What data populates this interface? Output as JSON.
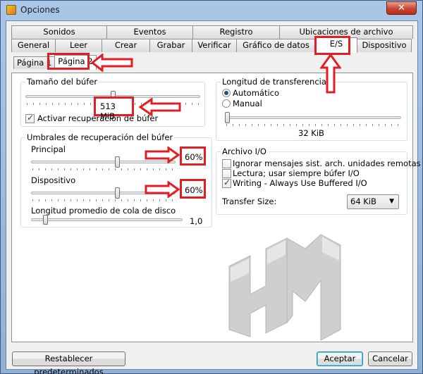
{
  "window": {
    "title": "Opciones",
    "close_glyph": "✕"
  },
  "tabs_row1": [
    "Sonidos",
    "Eventos",
    "Registro",
    "Ubicaciones de archivo"
  ],
  "tabs_row2": [
    "General",
    "Leer",
    "Crear",
    "Grabar",
    "Verificar",
    "Gráfico de datos",
    "E/S",
    "Dispositivo"
  ],
  "active_tab": "E/S",
  "subtabs": [
    "Página 1",
    "Página 2"
  ],
  "active_subtab": "Página 2",
  "buffer": {
    "title": "Tamaño del búfer",
    "value": "513 MiB",
    "slider_fraction": 0.5,
    "enable_recovery_label": "Activar recuperación de búfer",
    "enable_recovery_checked": true
  },
  "thresholds": {
    "title": "Umbrales de recuperación del búfer",
    "principal_label": "Principal",
    "principal_value": "60%",
    "principal_fraction": 0.6,
    "device_label": "Dispositivo",
    "device_value": "60%",
    "device_fraction": 0.6,
    "queue_label": "Longitud promedio de cola de disco",
    "queue_value": "1,0",
    "queue_fraction": 0.08
  },
  "transfer_length": {
    "title": "Longitud de transferencia",
    "auto_label": "Automático",
    "manual_label": "Manual",
    "selected": "Automático",
    "value": "32 KiB",
    "slider_fraction": 0.0
  },
  "file_io": {
    "title": "Archivo I/O",
    "ignore_label": "Ignorar mensajes sist. arch. unidades remotas",
    "ignore_checked": false,
    "read_label": "Lectura; usar siempre búfer I/O",
    "read_checked": false,
    "write_label": "Writing - Always Use Buffered I/O",
    "write_checked": true,
    "transfer_size_label": "Transfer Size:",
    "transfer_size_value": "64 KiB"
  },
  "buttons": {
    "reset": "Restablecer predeterminados",
    "accept": "Aceptar",
    "cancel": "Cancelar"
  },
  "colors": {
    "highlight": "#e21d24",
    "logo": "#c8c8c8"
  },
  "icons": {
    "dropdown": "▼",
    "app": "app-icon",
    "logo": "hm-logo-icon"
  }
}
